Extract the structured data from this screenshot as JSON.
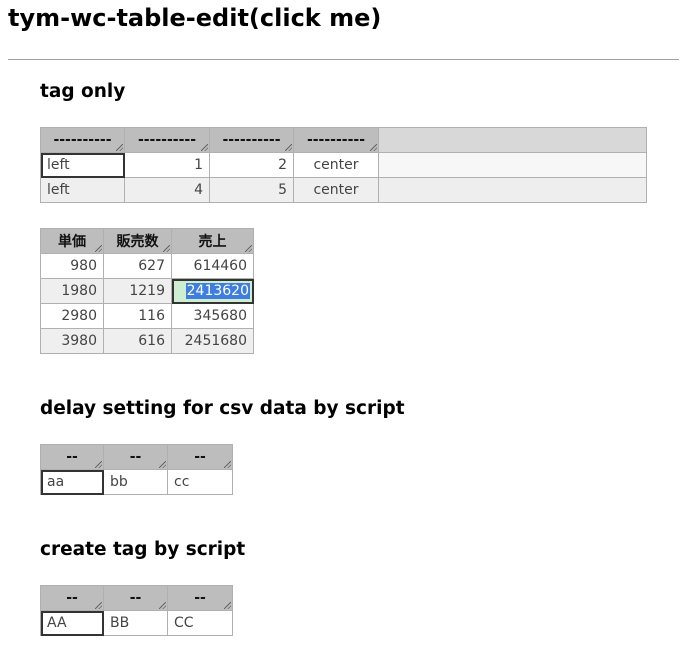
{
  "title": "tym-wc-table-edit(click me)",
  "sections": {
    "tag_only": "tag only",
    "delay": "delay setting for csv data by script",
    "create": "create tag by script"
  },
  "table1": {
    "headers": [
      "----------",
      "----------",
      "----------",
      "----------"
    ],
    "rows": [
      [
        "left",
        "1",
        "2",
        "center"
      ],
      [
        "left",
        "4",
        "5",
        "center"
      ]
    ]
  },
  "table2": {
    "headers": [
      "単価",
      "販売数",
      "売上"
    ],
    "rows": [
      [
        "980",
        "627",
        "614460"
      ],
      [
        "1980",
        "1219",
        "2413620"
      ],
      [
        "2980",
        "116",
        "345680"
      ],
      [
        "3980",
        "616",
        "2451680"
      ]
    ]
  },
  "table3": {
    "headers": [
      "--",
      "--",
      "--"
    ],
    "rows": [
      [
        "aa",
        "bb",
        "cc"
      ]
    ]
  },
  "table4": {
    "headers": [
      "--",
      "--",
      "--"
    ],
    "rows": [
      [
        "AA",
        "BB",
        "CC"
      ]
    ]
  },
  "colors": {
    "header_bg": "#bdbdbd",
    "edit_bg": "#cfeecf",
    "selection": "#3d7ee0"
  }
}
